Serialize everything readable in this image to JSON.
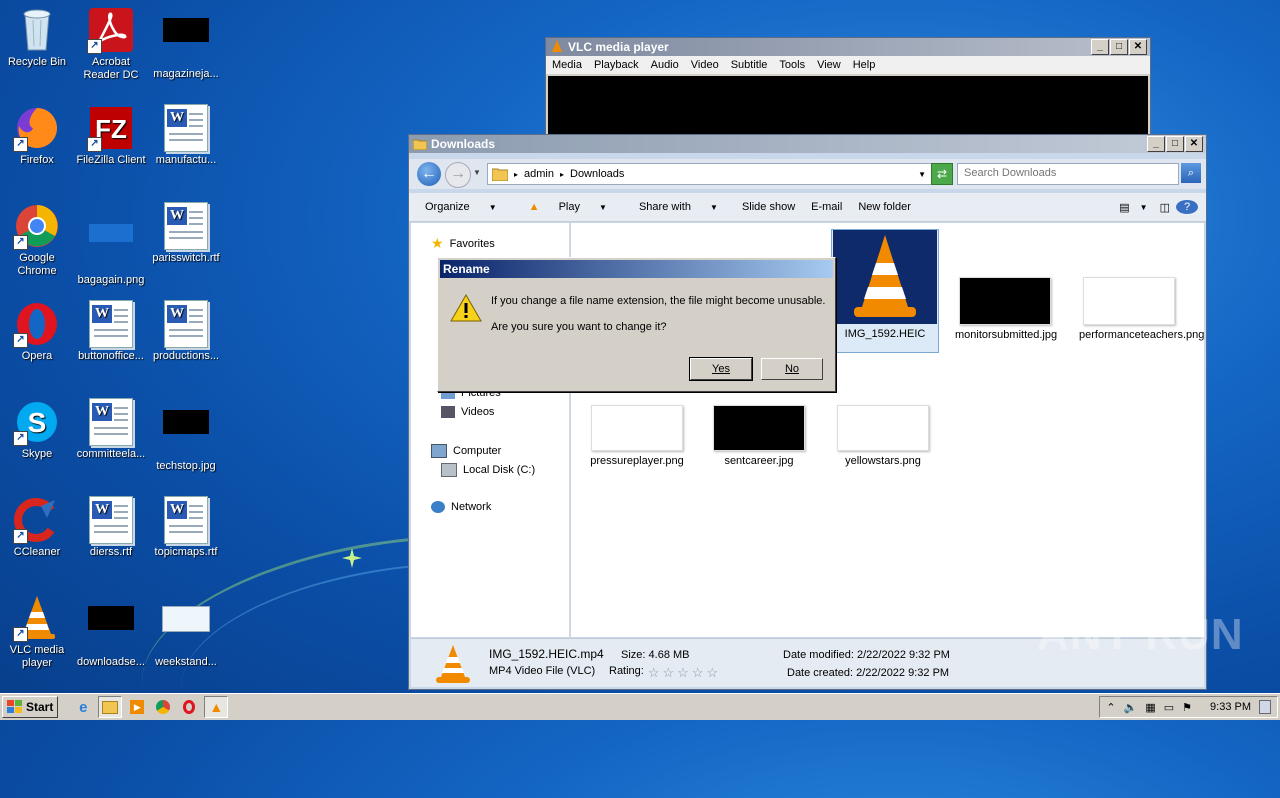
{
  "desktop": {
    "icons": [
      {
        "label": "Recycle Bin"
      },
      {
        "label": "Acrobat Reader DC"
      },
      {
        "label": "magazineja..."
      },
      {
        "label": "Firefox"
      },
      {
        "label": "FileZilla Client"
      },
      {
        "label": "manufactu..."
      },
      {
        "label": "Google Chrome"
      },
      {
        "label": "bagagain.png"
      },
      {
        "label": "parisswitch.rtf"
      },
      {
        "label": "Opera"
      },
      {
        "label": "buttonoffice..."
      },
      {
        "label": "productions..."
      },
      {
        "label": "Skype"
      },
      {
        "label": "committeela..."
      },
      {
        "label": "techstop.jpg"
      },
      {
        "label": "CCleaner"
      },
      {
        "label": "dierss.rtf"
      },
      {
        "label": "topicmaps.rtf"
      },
      {
        "label": "VLC media player"
      },
      {
        "label": "downloadse..."
      },
      {
        "label": "weekstand..."
      }
    ]
  },
  "vlc": {
    "title": "VLC media player",
    "menu": [
      "Media",
      "Playback",
      "Audio",
      "Video",
      "Subtitle",
      "Tools",
      "View",
      "Help"
    ]
  },
  "explorer": {
    "title": "Downloads",
    "breadcrumb": [
      "admin",
      "Downloads"
    ],
    "search_placeholder": "Search Downloads",
    "toolbar": {
      "organize": "Organize",
      "play": "Play",
      "share": "Share with",
      "slideshow": "Slide show",
      "email": "E-mail",
      "new_folder": "New folder"
    },
    "nav": {
      "favorites": "Favorites",
      "pictures": "Pictures",
      "videos": "Videos",
      "computer": "Computer",
      "local_disk": "Local Disk (C:)",
      "network": "Network"
    },
    "files": [
      {
        "name": "IMG_1592.HEIC"
      },
      {
        "name": "monitorsubmitted.jpg"
      },
      {
        "name": "performanceteachers.png"
      },
      {
        "name": "pressureplayer.png"
      },
      {
        "name": "sentcareer.jpg"
      },
      {
        "name": "yellowstars.png"
      }
    ],
    "details": {
      "filename": "IMG_1592.HEIC.mp4",
      "filetype": "MP4 Video File (VLC)",
      "size_label": "Size:",
      "size": "4.68 MB",
      "rating_label": "Rating:",
      "modified_label": "Date modified:",
      "modified": "2/22/2022 9:32 PM",
      "created_label": "Date created:",
      "created": "2/22/2022 9:32 PM"
    }
  },
  "dialog": {
    "title": "Rename",
    "message": "If you change a file name extension, the file might become unusable.",
    "question": "Are you sure you want to change it?",
    "yes": "Yes",
    "no": "No"
  },
  "taskbar": {
    "start": "Start",
    "clock": "9:33 PM"
  },
  "watermark": "ANY RUN"
}
